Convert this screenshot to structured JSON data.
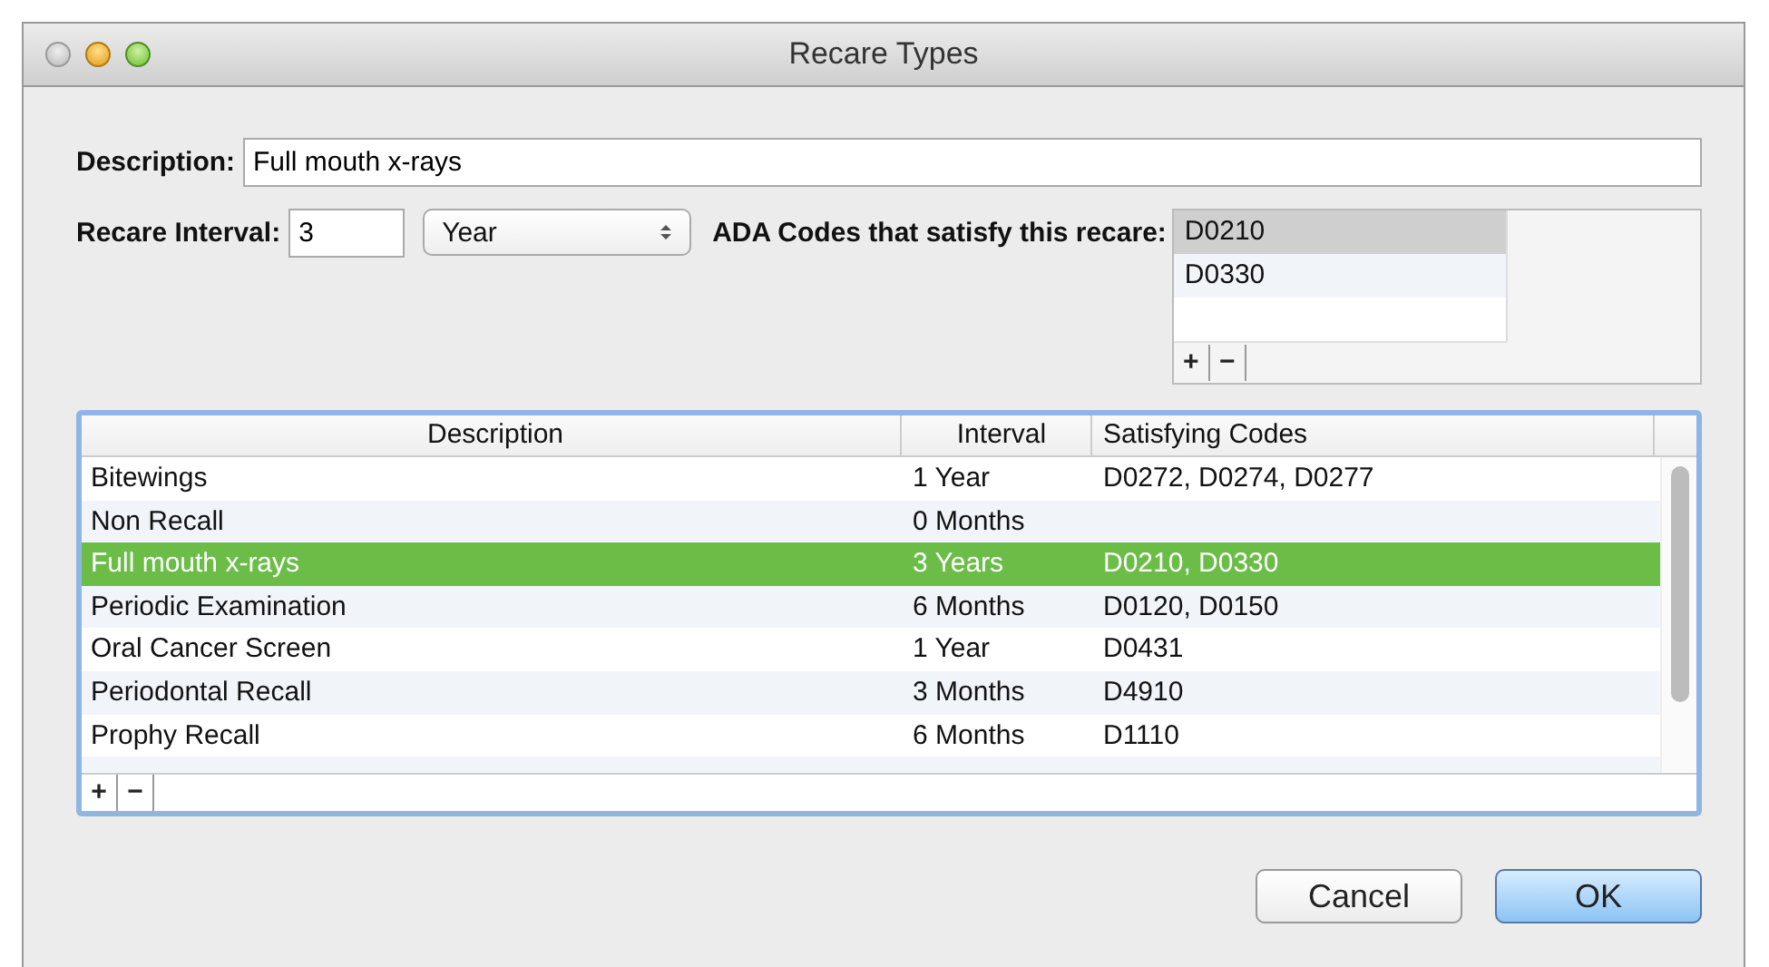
{
  "window": {
    "title": "Recare Types"
  },
  "description": {
    "label": "Description:",
    "value": "Full mouth x-rays"
  },
  "recare_interval": {
    "label": "Recare Interval:",
    "value": "3",
    "unit": "Year"
  },
  "ada_codes": {
    "label": "ADA Codes that satisfy this recare:",
    "items": [
      {
        "code": "D0210",
        "selected": true
      },
      {
        "code": "D0330",
        "selected": false
      }
    ],
    "add": "+",
    "remove": "−"
  },
  "table": {
    "columns": [
      "Description",
      "Interval",
      "Satisfying Codes"
    ],
    "rows": [
      {
        "description": "Bitewings",
        "interval": "1 Year",
        "codes": "D0272, D0274, D0277",
        "selected": false
      },
      {
        "description": "Non Recall",
        "interval": "0 Months",
        "codes": "",
        "selected": false
      },
      {
        "description": "Full mouth x-rays",
        "interval": "3 Years",
        "codes": "D0210, D0330",
        "selected": true
      },
      {
        "description": "Periodic Examination",
        "interval": "6 Months",
        "codes": "D0120, D0150",
        "selected": false
      },
      {
        "description": "Oral Cancer Screen",
        "interval": "1 Year",
        "codes": "D0431",
        "selected": false
      },
      {
        "description": "Periodontal Recall",
        "interval": "3 Months",
        "codes": "D4910",
        "selected": false
      },
      {
        "description": "Prophy Recall",
        "interval": "6 Months",
        "codes": "D1110",
        "selected": false
      }
    ],
    "add": "+",
    "remove": "−"
  },
  "buttons": [
    {
      "label": "Cancel",
      "kind": "normal"
    },
    {
      "label": "OK",
      "kind": "default"
    }
  ]
}
